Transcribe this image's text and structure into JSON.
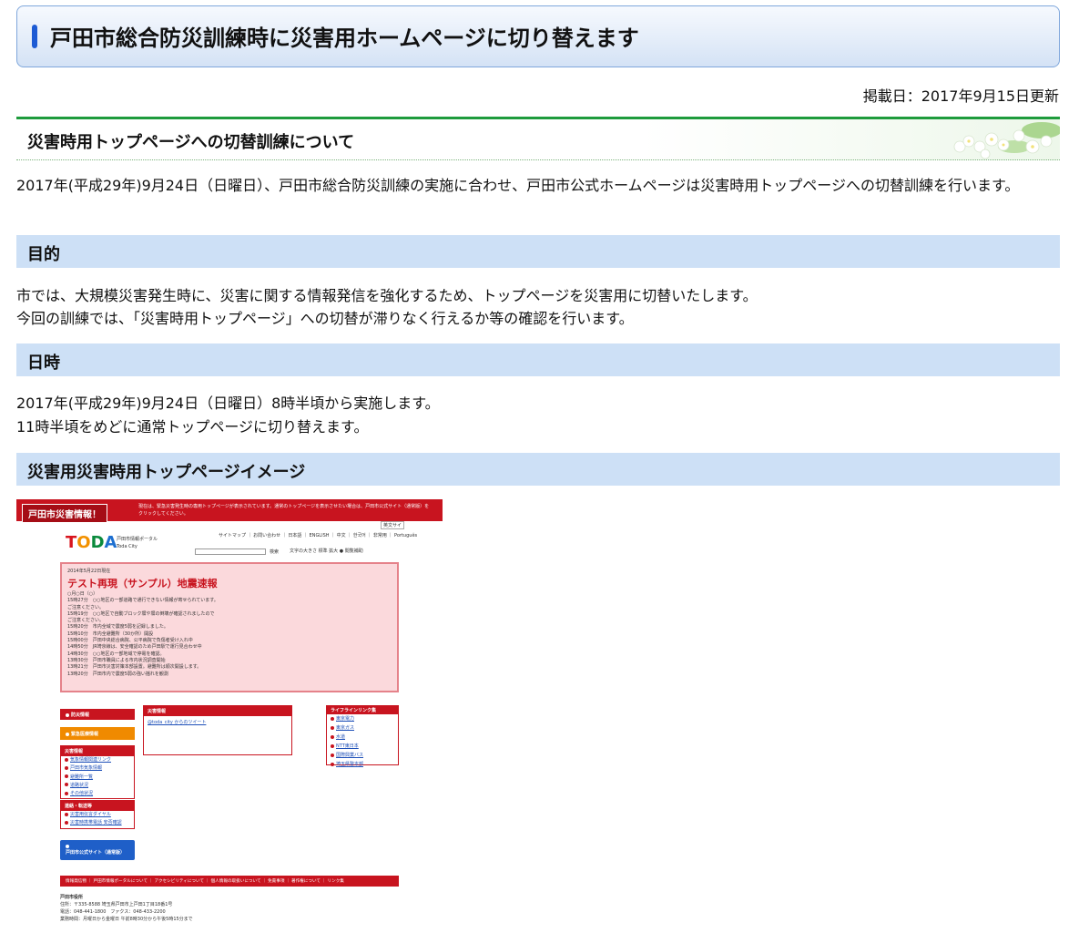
{
  "title": "戸田市総合防災訓練時に災害用ホームページに切り替えます",
  "posted_date": "掲載日：2017年9月15日更新",
  "section_main": "災害時用トップページへの切替訓練について",
  "intro": "2017年(平成29年)9月24日（日曜日）、戸田市総合防災訓練の実施に合わせ、戸田市公式ホームページは災害時用トップページへの切替訓練を行います。",
  "purpose": {
    "heading": "目的",
    "line1": "市では、大規模災害発生時に、災害に関する情報発信を強化するため、トップページを災害用に切替いたします。",
    "line2": "今回の訓練では、「災害時用トップページ」への切替が滞りなく行えるか等の確認を行います。"
  },
  "datetime": {
    "heading": "日時",
    "line1": "2017年(平成29年)9月24日（日曜日）8時半頃から実施します。",
    "line2": "11時半頃をめどに通常トップページに切り替えます。"
  },
  "image_section": {
    "heading": "災害用災害時用トップページイメージ"
  },
  "screenshot": {
    "header_title": "戸田市災害情報！",
    "header_note": "現在は、緊急災害発生時の専用トップページが表示されています。通常のトップページを表示させたい場合は、戸田市公式サイト（通常版）をクリックしてください。",
    "logo": [
      "T",
      "O",
      "D",
      "A"
    ],
    "logo_sub": "戸田市情報ポータル\nToda City",
    "top_links": "サイトマップ ｜ お問い合わせ ｜ 日本語 ｜ ENGLISH ｜ 中文 ｜ 한국어 ｜ 非常用 ｜ Português",
    "english_btn": "英文サイ",
    "search_btn": "検索",
    "font_size": "文字の大きさ 標準 拡大 ● 閲覧補助",
    "alert_date": "2014年5月22日現在",
    "alert_title": "テスト再現（サンプル）地震速報",
    "alert_lines": [
      "○月○日（○）",
      "15時27分　○○地区の一部道路で通行できない情報が寄せられています。",
      "ご注意ください。",
      "15時19分　○○地区で自動ブロック塀や塀の倒壊が確認されましたので",
      "ご注意ください。",
      "15時20分　市内全域で震度5弱を記録しました。",
      "15時10分　市内全避難所（30か所）開設",
      "15時00分　戸田中央総合病院、公平病院で負傷者受け入れ中",
      "14時50分　JR埼京線は、安全確認のため戸田駅で運行見合わせ中",
      "14時30分　○○地区の一部地域で停電を確認。",
      "13時30分　戸田市職員による市内状況調査開始",
      "13時21分　戸田市災害対策本部設置。避難所は順次開設します。",
      "13時20分　戸田市内で震度5弱の強い揺れを観測"
    ],
    "nav_disaster": "防災情報",
    "nav_emergency": "緊急医療情報",
    "nav_box1_title": "災害情報",
    "nav_box1_items": [
      "気象情報関連リンク",
      "戸田市気象情報",
      "避難所一覧",
      "道路状況",
      "その他状況"
    ],
    "nav_box2_title": "連絡・転送等",
    "nav_box2_items": [
      "災害用伝言ダイヤル",
      "災害時携帯電話 安否確認"
    ],
    "nav_official": "戸田市公式サイト（通常版）",
    "news_title": "災害情報",
    "news_item": "@toda_city からのツイート",
    "lifeline_title": "ライフラインリンク集",
    "lifeline_items": [
      "東京電力",
      "東京ガス",
      "水道",
      "NTT東日本",
      "国際興業バス",
      "埼玉県警本部"
    ],
    "footer_nav": "情報発信物 ｜ 戸田市情報ポータルについて ｜ アクセシビリティについて ｜ 個人情報の取扱いについて ｜ 免責事項 ｜ 著作権について ｜ リンク集",
    "footer_name": "戸田市役所",
    "footer_addr": "住所：〒335-8588 埼玉県戸田市上戸田1丁目18番1号",
    "footer_tel": "電話：048-441-1800　ファクス：048-433-2200",
    "footer_hours": "業務時間：月曜日から金曜日 午前8時30分から午後5時15分まで"
  }
}
